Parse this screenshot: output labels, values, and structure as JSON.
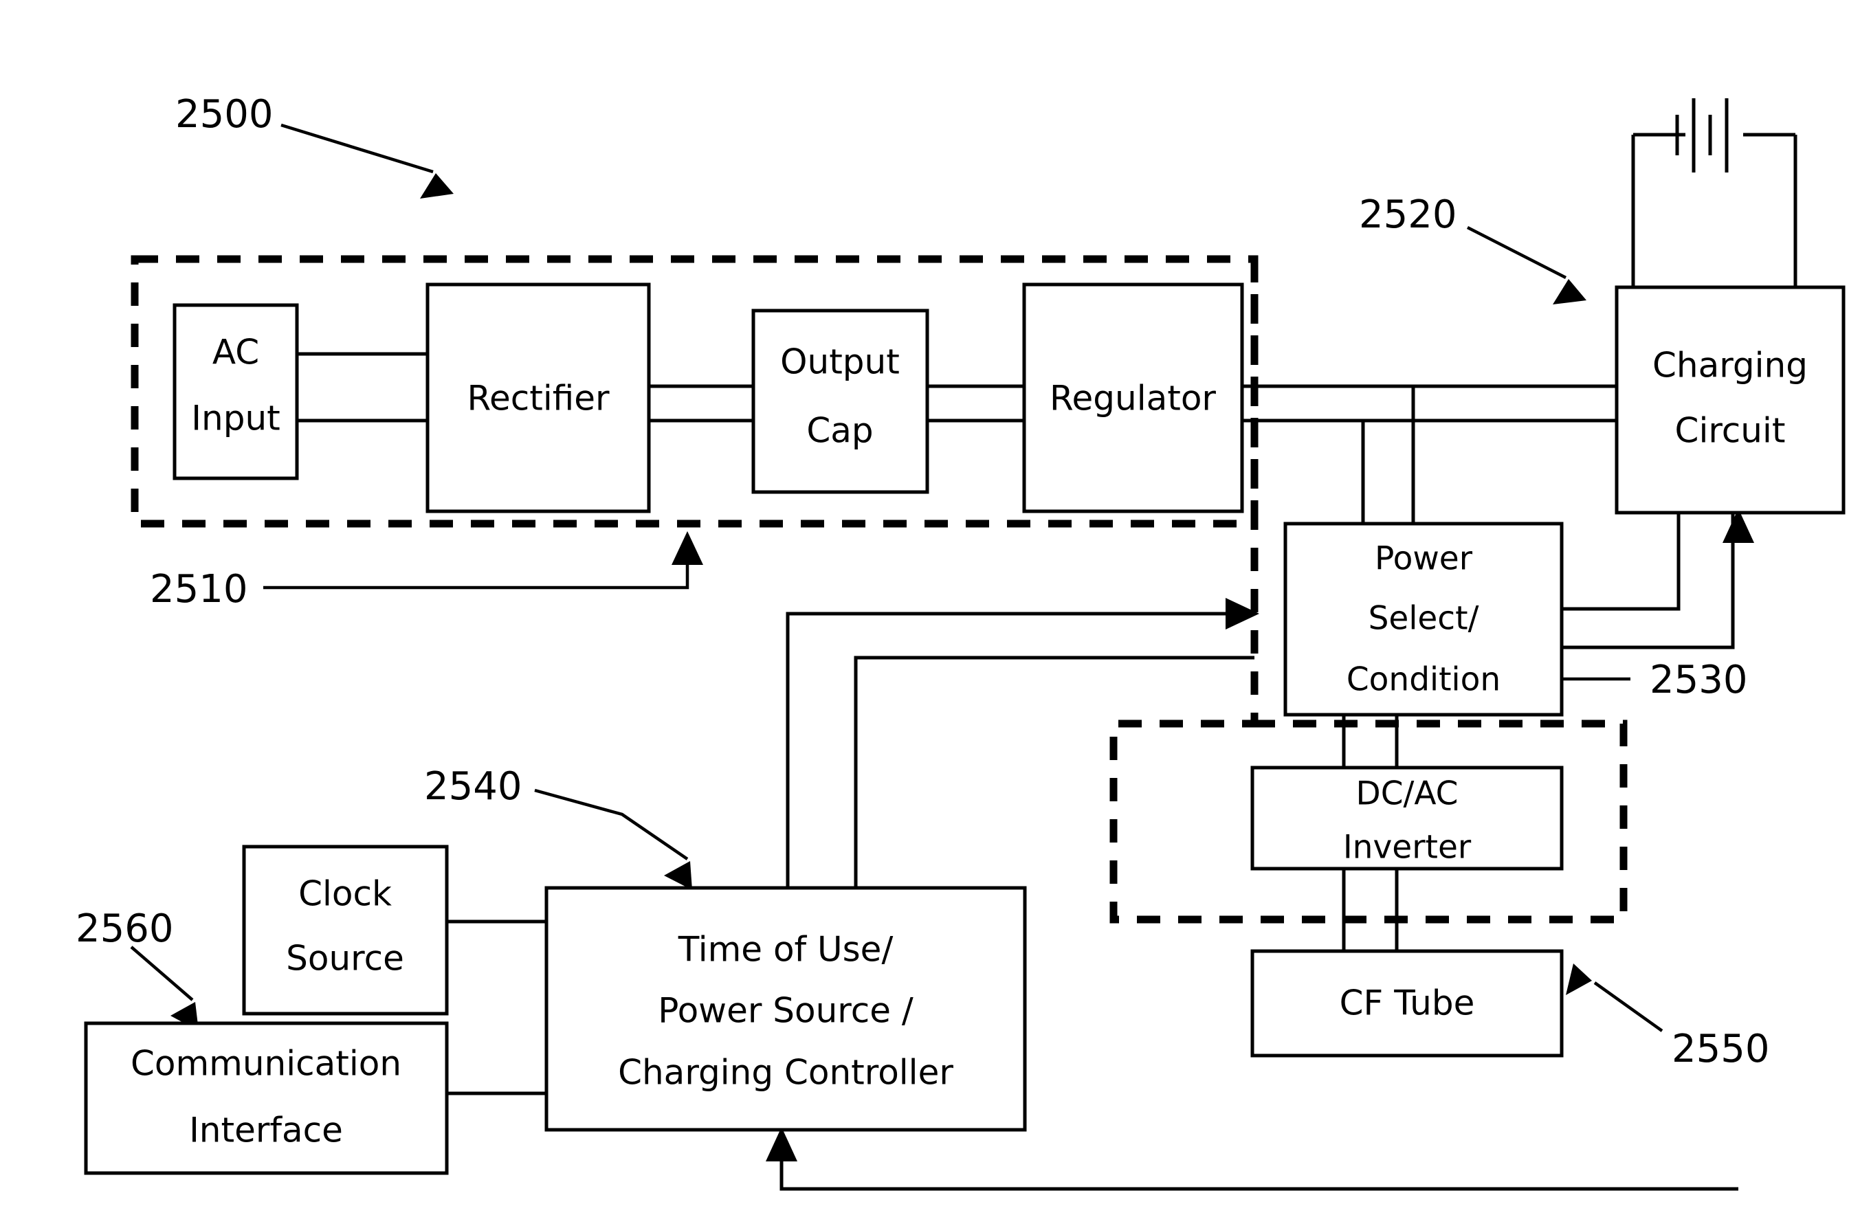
{
  "figure": {
    "type": "patent-block-diagram",
    "background_color": "#ffffff",
    "line_color": "#000000"
  },
  "blocks": {
    "ac_input": {
      "line1": "AC",
      "line2": "Input"
    },
    "rectifier": {
      "line1": "Rectifier"
    },
    "output_cap": {
      "line1": "Output",
      "line2": "Cap"
    },
    "regulator": {
      "line1": "Regulator"
    },
    "charging_circuit": {
      "line1": "Charging",
      "line2": "Circuit"
    },
    "power_select": {
      "line1": "Power",
      "line2": "Select/",
      "line3": "Condition"
    },
    "dc_ac_inverter": {
      "line1": "DC/AC",
      "line2": "Inverter"
    },
    "cf_tube": {
      "line1": "CF Tube"
    },
    "controller": {
      "line1": "Time of Use/",
      "line2": "Power Source /",
      "line3": "Charging Controller"
    },
    "clock_source": {
      "line1": "Clock",
      "line2": "Source"
    },
    "communication_interface": {
      "line1": "Communication",
      "line2": "Interface"
    }
  },
  "reference_numerals": {
    "n2500": "2500",
    "n2510": "2510",
    "n2520": "2520",
    "n2530": "2530",
    "n2540": "2540",
    "n2550": "2550",
    "n2560": "2560"
  },
  "symbols": {
    "battery": "battery-cell-symbol"
  }
}
